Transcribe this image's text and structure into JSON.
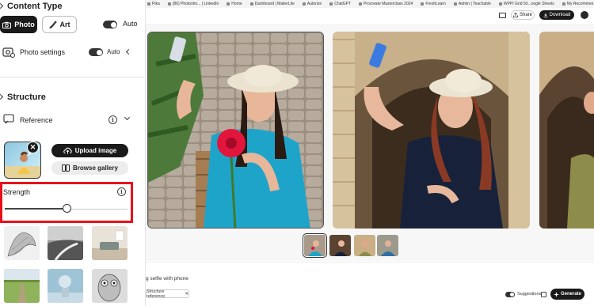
{
  "bookmarks": [
    {
      "label": "Pika"
    },
    {
      "label": "(86) Photosho... | LinkedIn"
    },
    {
      "label": "Home"
    },
    {
      "label": "Dashboard | MailerLite"
    },
    {
      "label": "Autorize"
    },
    {
      "label": "ChatGPT"
    },
    {
      "label": "Procreate Masterclass 2024"
    },
    {
      "label": "FreshLearn"
    },
    {
      "label": "Admin | Teachable"
    },
    {
      "label": "WPPI Grid 50...oogle Sheets"
    },
    {
      "label": "My Recommen...Colin Smith"
    }
  ],
  "toolbar": {
    "share_label": "Share",
    "download_label": "Download"
  },
  "left_panel": {
    "content_type_title": "Content Type",
    "photo_label": "Photo",
    "art_label": "Art",
    "auto_label": "Auto",
    "photo_settings_label": "Photo settings",
    "photo_settings_auto": "Auto",
    "structure_title": "Structure",
    "reference_label": "Reference",
    "upload_image_label": "Upload image",
    "browse_gallery_label": "Browse gallery",
    "strength_label": "Strength",
    "strength_value": 0.5
  },
  "prompt": {
    "text": "g selfie with phone",
    "reference_chip": "Structure reference",
    "suggestions_label": "Suggestions",
    "generate_label": "Generate"
  },
  "colors": {
    "highlight": "#e8111b",
    "dark": "#1a1a1a"
  }
}
